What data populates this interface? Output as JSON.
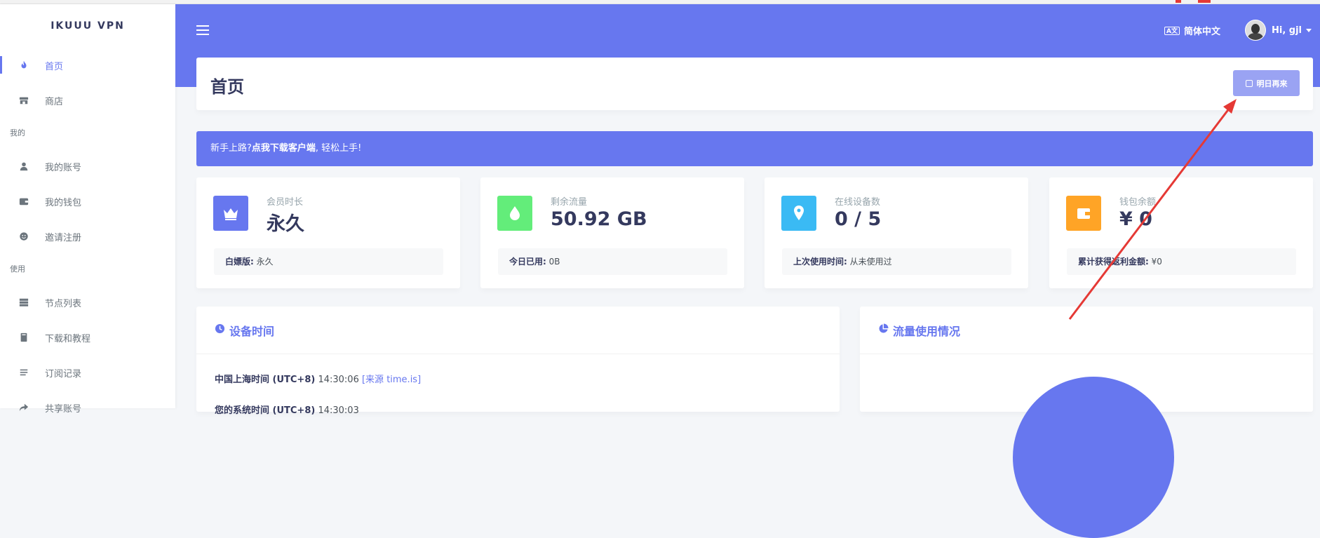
{
  "brand": "IKUUU VPN",
  "sidebar": {
    "items": [
      {
        "label": "首页",
        "icon": "fire-icon"
      },
      {
        "label": "商店",
        "icon": "store-icon"
      }
    ],
    "section_mine": "我的",
    "mine_items": [
      {
        "label": "我的账号",
        "icon": "user-icon"
      },
      {
        "label": "我的钱包",
        "icon": "wallet-icon"
      },
      {
        "label": "邀请注册",
        "icon": "smile-icon"
      }
    ],
    "section_use": "使用",
    "use_items": [
      {
        "label": "节点列表",
        "icon": "server-icon"
      },
      {
        "label": "下载和教程",
        "icon": "book-icon"
      },
      {
        "label": "订阅记录",
        "icon": "list-icon"
      },
      {
        "label": "共享账号",
        "icon": "share-icon"
      }
    ]
  },
  "topbar": {
    "lang_badge": "A文",
    "lang_label": "简体中文",
    "user_label": "Hi, gjl"
  },
  "page": {
    "title": "首页",
    "checkin_label": "明日再来"
  },
  "alert": {
    "prefix": "新手上路?",
    "link": "点我下载客户端",
    "suffix": ", 轻松上手!"
  },
  "stats": [
    {
      "label": "会员时长",
      "value": "永久",
      "foot_label": "白嫖版:",
      "foot_value": "永久",
      "color": "#6777ef",
      "icon": "crown-icon"
    },
    {
      "label": "剩余流量",
      "value": "50.92 GB",
      "foot_label": "今日已用:",
      "foot_value": "0B",
      "color": "#63ed7a",
      "icon": "droplet-icon"
    },
    {
      "label": "在线设备数",
      "value": "0 / 5",
      "foot_label": "上次使用时间:",
      "foot_value": "从未使用过",
      "color": "#3abaf4",
      "icon": "map-marker-icon"
    },
    {
      "label": "钱包余额",
      "value": "¥ 0",
      "foot_label": "累计获得返利金额:",
      "foot_value": "¥0",
      "color": "#ffa426",
      "icon": "wallet-icon"
    }
  ],
  "device_time": {
    "title": "设备时间",
    "line1_label": "中国上海时间 (UTC+8)",
    "line1_value": "14:30:06",
    "line1_source": "[来源 time.is]",
    "line2_label": "您的系统时间 (UTC+8)",
    "line2_value": "14:30:03"
  },
  "traffic": {
    "title": "流量使用情况"
  },
  "colors": {
    "accent": "#6777ef",
    "annotation_arrow": "#e53935"
  }
}
